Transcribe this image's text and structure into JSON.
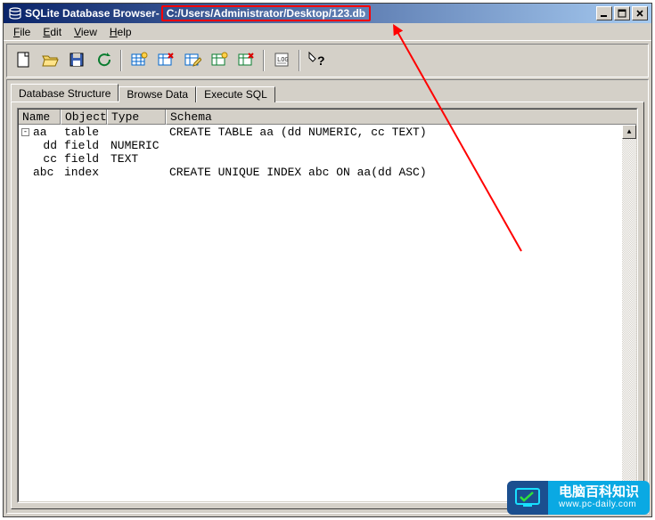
{
  "titlebar": {
    "app_name": "SQLite Database Browser",
    "separator": " - ",
    "file_path": "C:/Users/Administrator/Desktop/123.db"
  },
  "menubar": {
    "items": [
      "File",
      "Edit",
      "View",
      "Help"
    ]
  },
  "toolbar": {
    "buttons": [
      {
        "name": "new-db-button",
        "icon": "new"
      },
      {
        "name": "open-db-button",
        "icon": "open"
      },
      {
        "name": "save-db-button",
        "icon": "save"
      },
      {
        "name": "revert-button",
        "icon": "revert"
      },
      {
        "sep": true
      },
      {
        "name": "create-table-button",
        "icon": "table-new"
      },
      {
        "name": "delete-table-button",
        "icon": "table-del"
      },
      {
        "name": "modify-table-button",
        "icon": "table-edit"
      },
      {
        "name": "create-index-button",
        "icon": "index-new"
      },
      {
        "name": "delete-index-button",
        "icon": "index-del"
      },
      {
        "sep": true
      },
      {
        "name": "log-button",
        "icon": "log"
      },
      {
        "sep": true
      },
      {
        "name": "whatsthis-button",
        "icon": "help"
      }
    ]
  },
  "tabs": [
    {
      "id": "structure",
      "label": "Database Structure",
      "active": true
    },
    {
      "id": "browse",
      "label": "Browse Data",
      "active": false
    },
    {
      "id": "sql",
      "label": "Execute SQL",
      "active": false
    }
  ],
  "structure": {
    "columns": [
      "Name",
      "Object",
      "Type",
      "Schema"
    ],
    "rows": [
      {
        "indent": 0,
        "expand": "-",
        "name": "aa",
        "object": "table",
        "type": "",
        "schema": "CREATE TABLE aa (dd NUMERIC, cc TEXT)"
      },
      {
        "indent": 1,
        "expand": "",
        "name": "dd",
        "object": "field",
        "type": "NUMERIC",
        "schema": ""
      },
      {
        "indent": 1,
        "expand": "",
        "name": "cc",
        "object": "field",
        "type": "TEXT",
        "schema": ""
      },
      {
        "indent": 0,
        "expand": "",
        "name": "abc",
        "object": "index",
        "type": "",
        "schema": "CREATE UNIQUE INDEX abc ON aa(dd ASC)"
      }
    ]
  },
  "watermark": {
    "line1": "电脑百科知识",
    "line2": "www.pc-daily.com"
  }
}
